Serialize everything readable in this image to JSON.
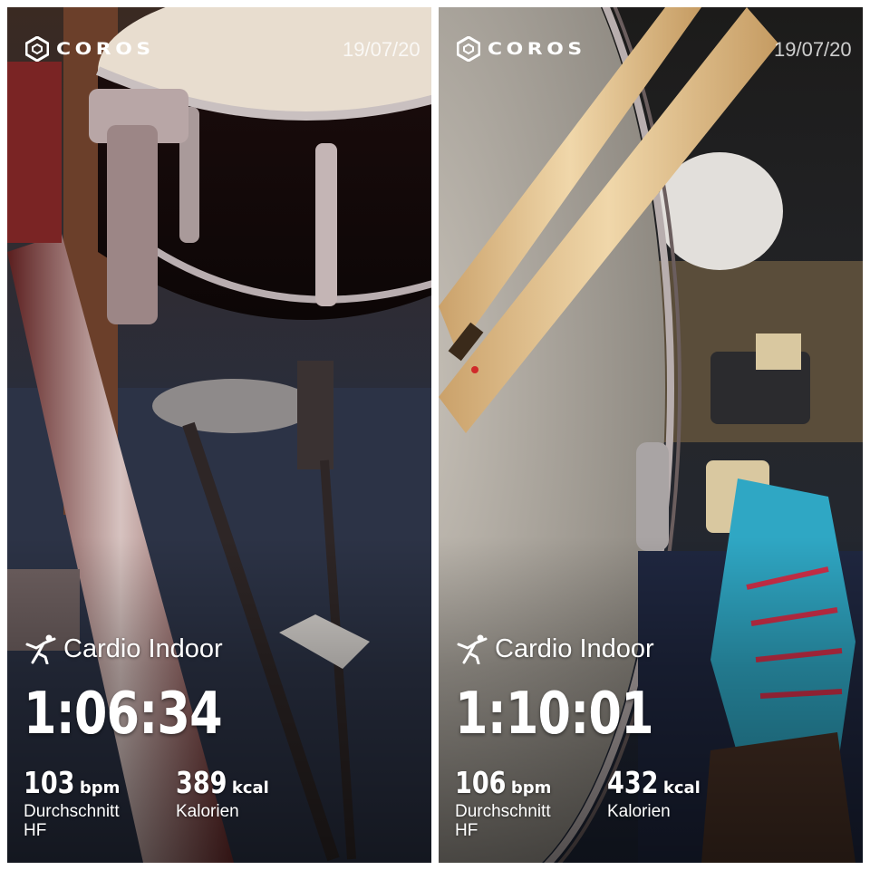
{
  "colors": {
    "text": "#ffffff",
    "date_text": "#d9d9d9",
    "divider": "#ffffff"
  },
  "panels": [
    {
      "brand": {
        "name": "COROS",
        "icon": "coros-hexagon-logo-icon"
      },
      "date": "19/07/20",
      "activity": {
        "icon": "cardio-figure-icon",
        "name": "Cardio Indoor"
      },
      "duration": "1:06:34",
      "heart_rate": {
        "value": "103",
        "unit": "bpm",
        "label": "Durchschnitt\nHF"
      },
      "calories": {
        "value": "389",
        "unit": "kcal",
        "label": "Kalorien"
      }
    },
    {
      "brand": {
        "name": "COROS",
        "icon": "coros-hexagon-logo-icon"
      },
      "date": "19/07/20",
      "activity": {
        "icon": "cardio-figure-icon",
        "name": "Cardio Indoor"
      },
      "duration": "1:10:01",
      "heart_rate": {
        "value": "106",
        "unit": "bpm",
        "label": "Durchschnitt\nHF"
      },
      "calories": {
        "value": "432",
        "unit": "kcal",
        "label": "Kalorien"
      }
    }
  ]
}
